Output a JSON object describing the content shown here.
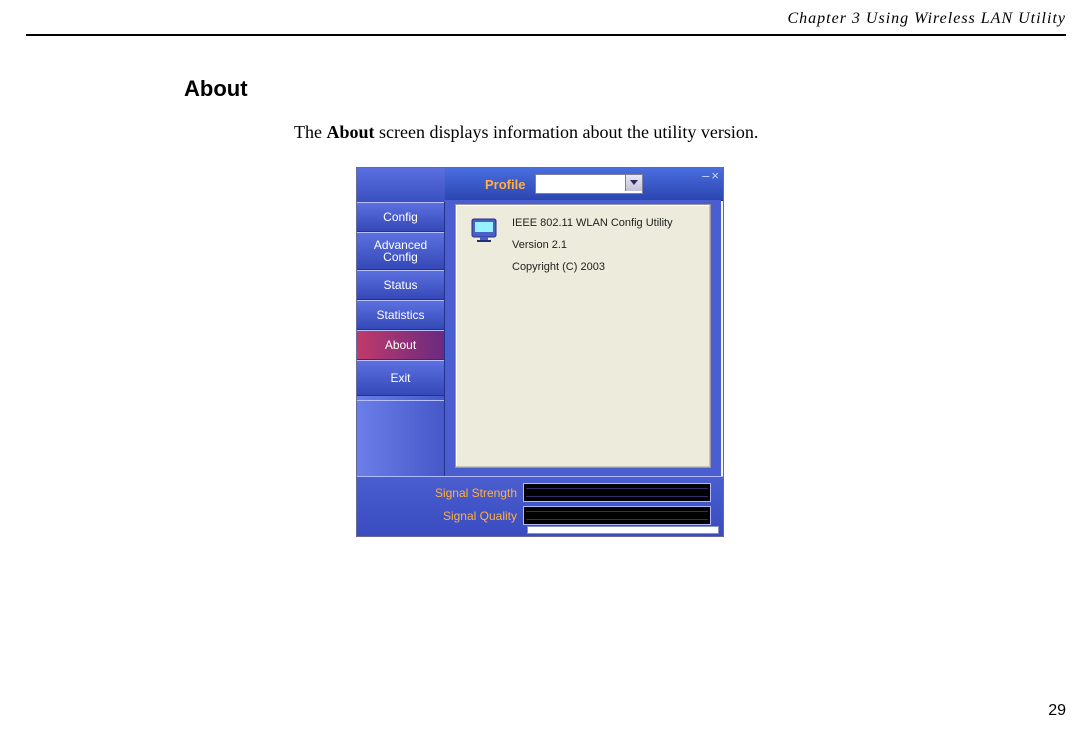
{
  "doc": {
    "chapter_header": "Chapter 3  Using Wireless LAN Utility",
    "section_title": "About",
    "intro_prefix": "The ",
    "intro_bold": "About",
    "intro_suffix": " screen displays information about the utility version.",
    "page_number": "29"
  },
  "app": {
    "profile_label": "Profile",
    "profile_value": "",
    "minimize_glyph": "–",
    "close_glyph": "×",
    "tabs": {
      "config": "Config",
      "advanced": "Advanced\nConfig",
      "status": "Status",
      "statistics": "Statistics",
      "about": "About",
      "exit": "Exit"
    },
    "about_pane": {
      "line1": "IEEE 802.11 WLAN Config Utility",
      "line2": "Version 2.1",
      "line3": "Copyright (C) 2003"
    },
    "footer": {
      "signal_strength_label": "Signal Strength",
      "signal_quality_label": "Signal Quality"
    }
  }
}
